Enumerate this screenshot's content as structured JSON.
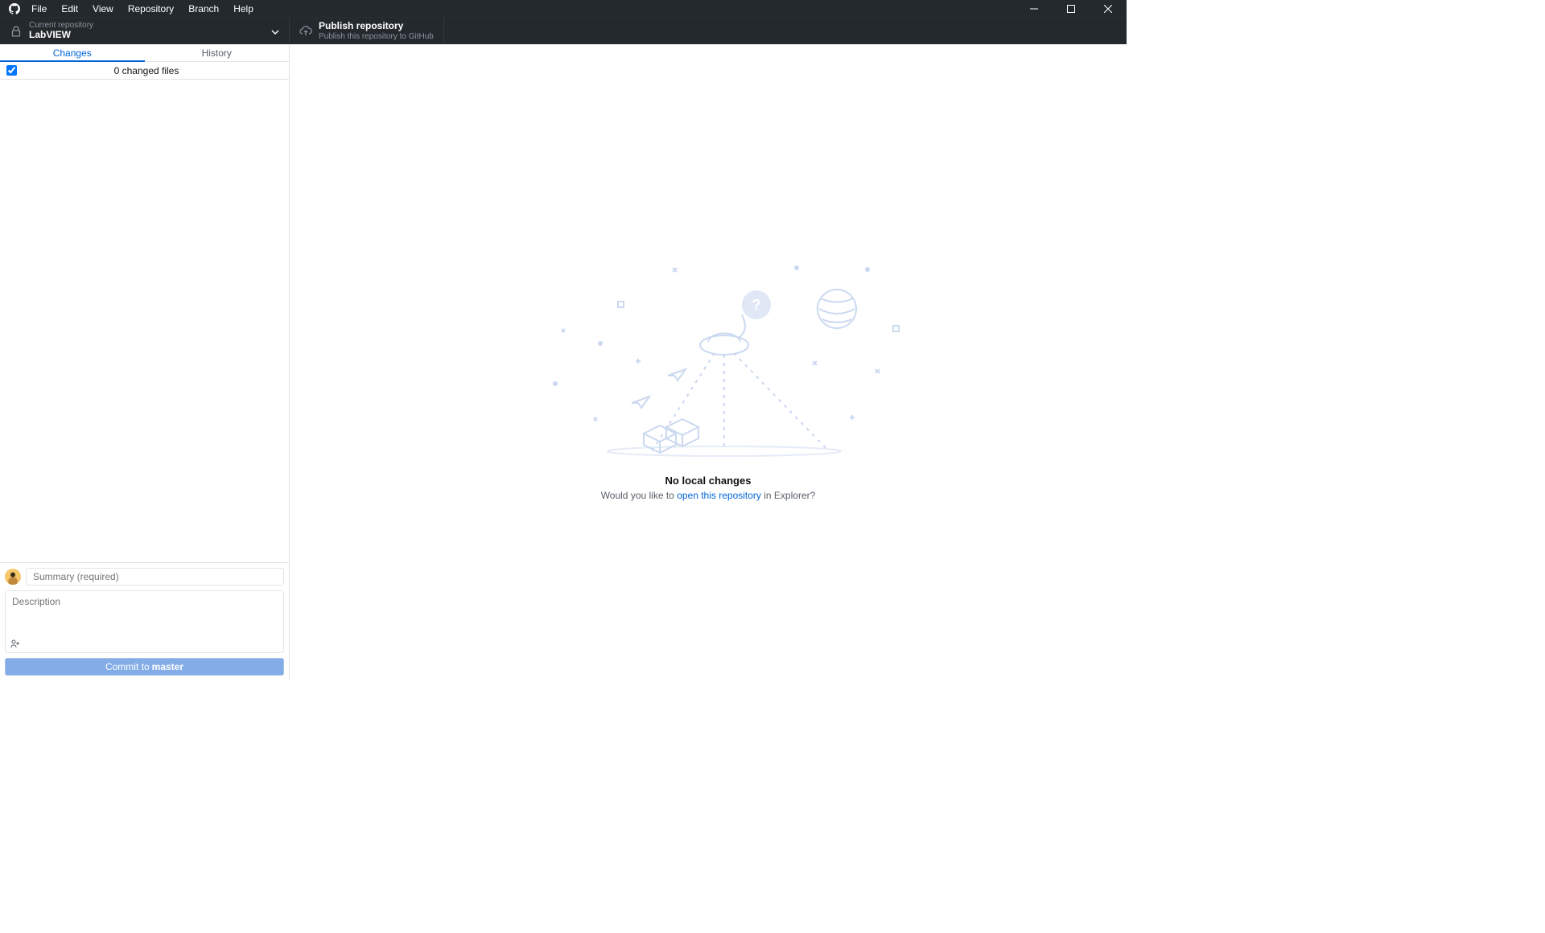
{
  "menu": {
    "items": [
      "File",
      "Edit",
      "View",
      "Repository",
      "Branch",
      "Help"
    ]
  },
  "toolbar": {
    "repo": {
      "label": "Current repository",
      "value": "LabVIEW"
    },
    "publish": {
      "label": "Publish repository",
      "value": "Publish this repository to GitHub"
    }
  },
  "sidebar": {
    "tabs": {
      "changes": "Changes",
      "history": "History"
    },
    "changed_files": "0 changed files"
  },
  "commit": {
    "summary_placeholder": "Summary (required)",
    "description_placeholder": "Description",
    "button_prefix": "Commit to ",
    "branch": "master"
  },
  "empty": {
    "title": "No local changes",
    "sub_prefix": "Would you like to ",
    "link": "open this repository",
    "sub_suffix": " in Explorer?"
  }
}
